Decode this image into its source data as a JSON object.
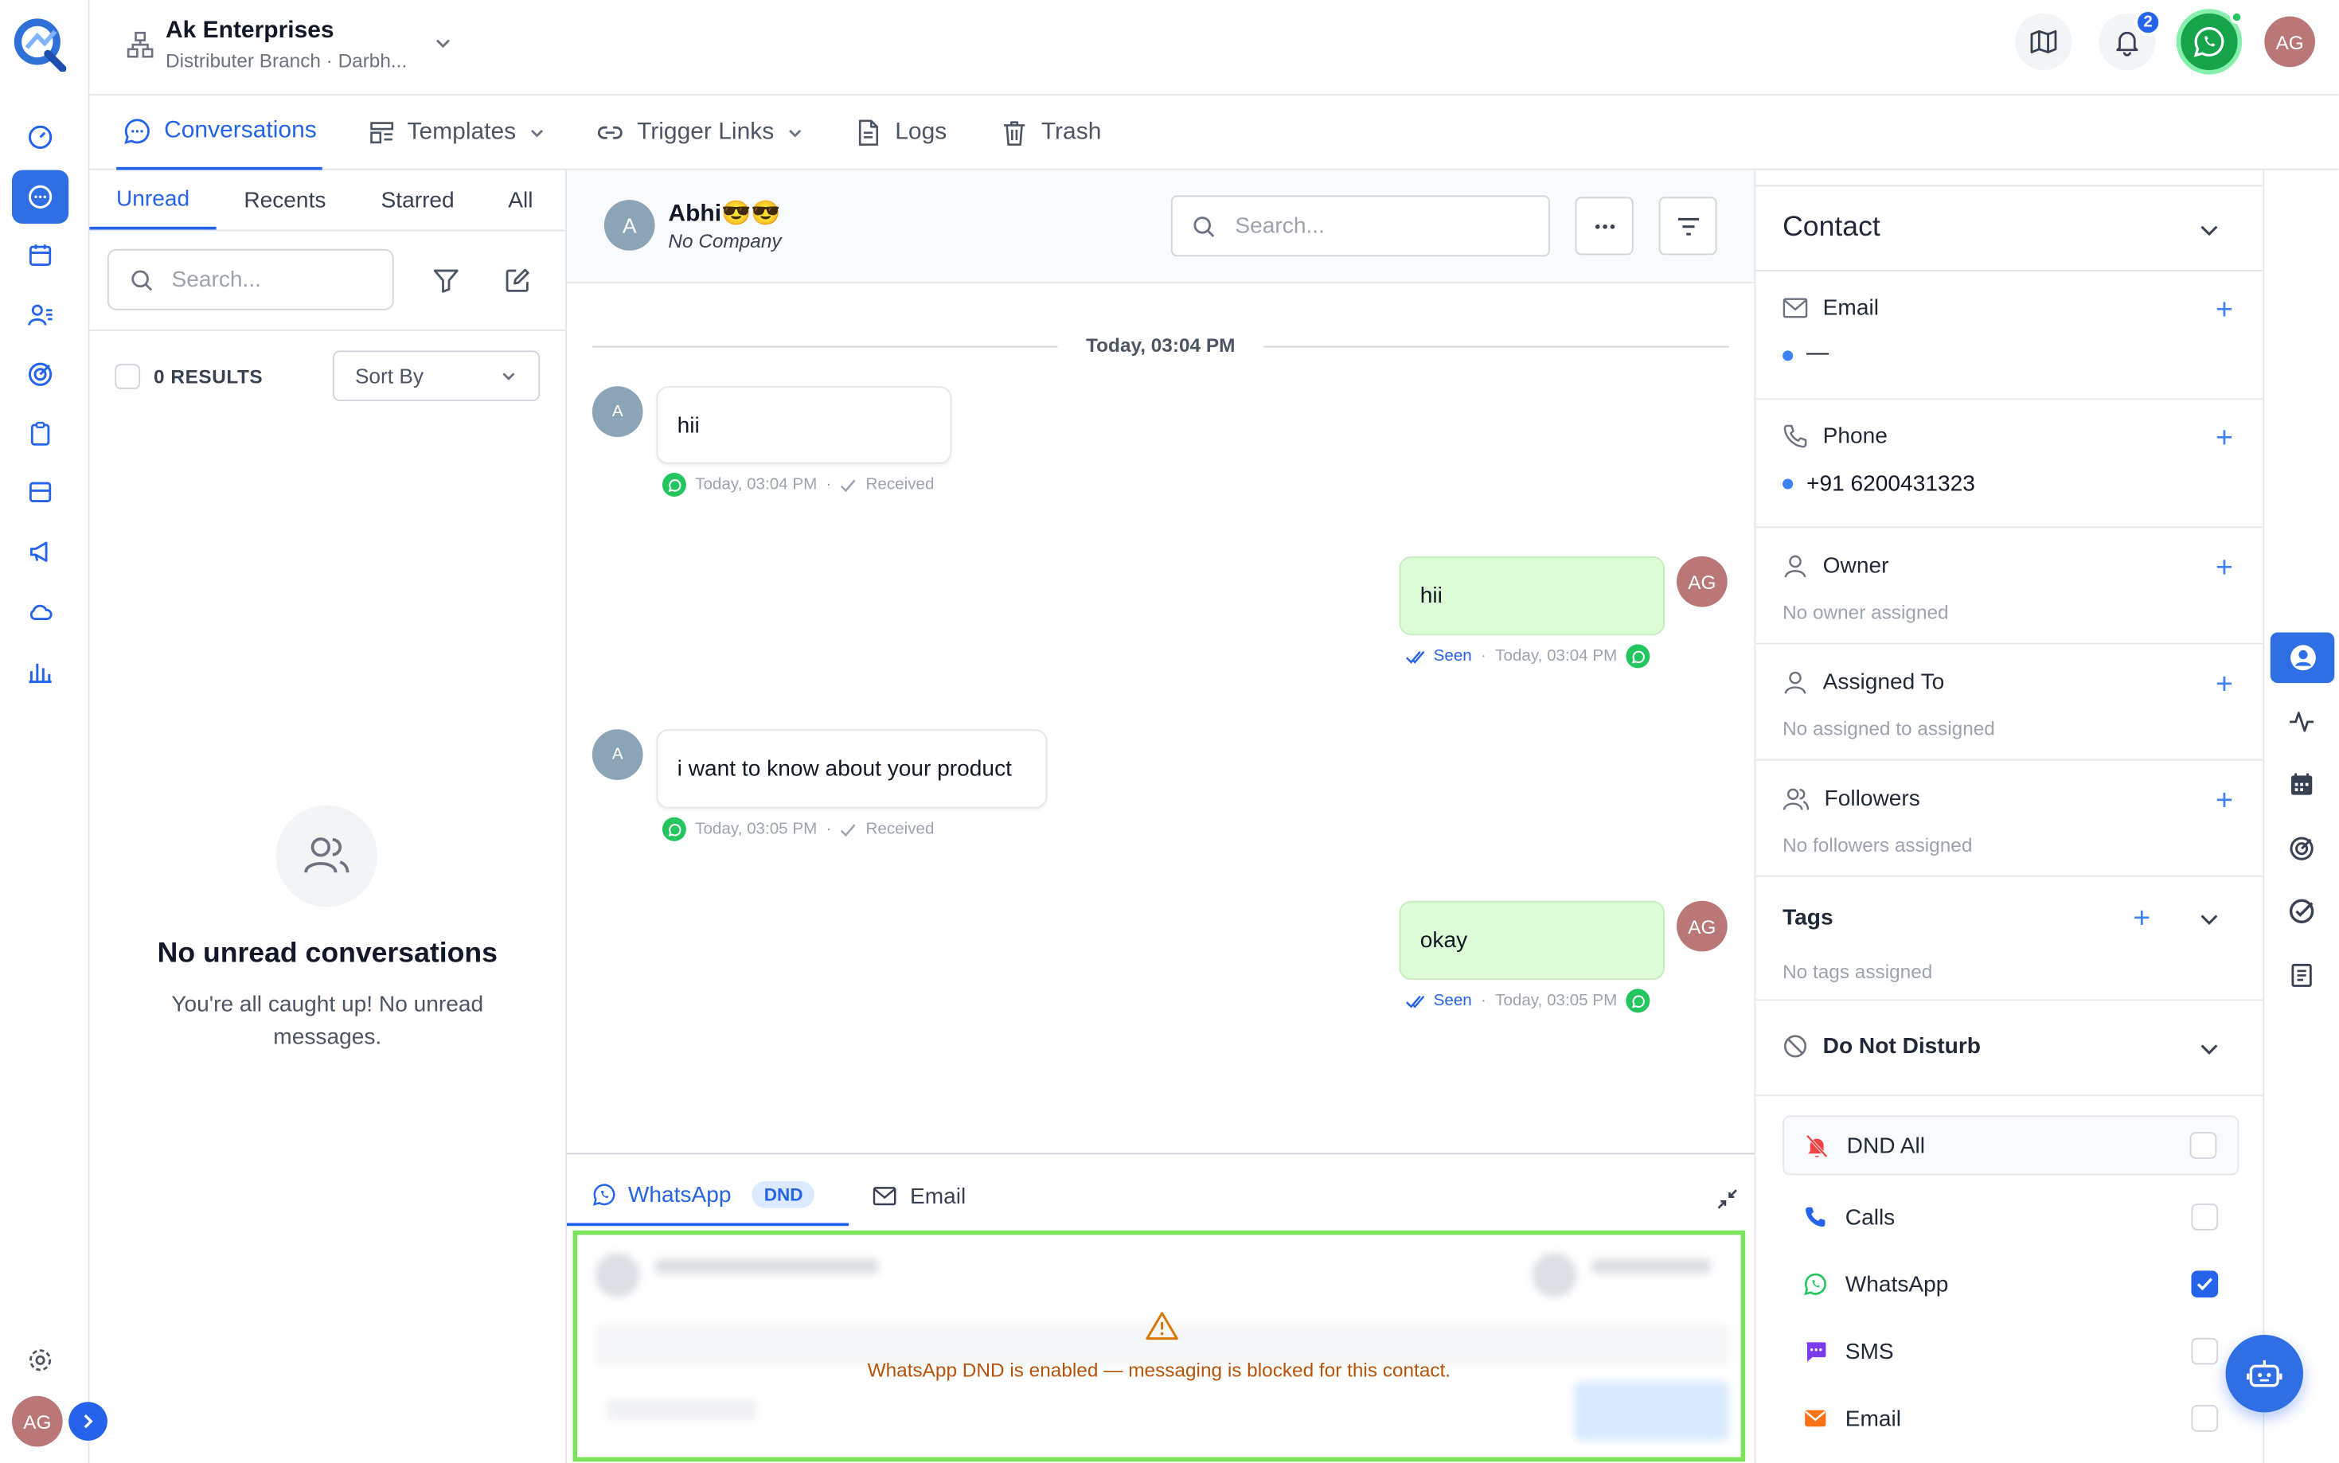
{
  "header": {
    "org_name": "Ak Enterprises",
    "org_sub": "Distributer Branch · Darbh...",
    "notification_count": "2",
    "user_initials": "AG"
  },
  "tabs": [
    {
      "label": "Conversations"
    },
    {
      "label": "Templates"
    },
    {
      "label": "Trigger Links"
    },
    {
      "label": "Logs"
    },
    {
      "label": "Trash"
    }
  ],
  "list": {
    "subtabs": [
      "Unread",
      "Recents",
      "Starred",
      "All"
    ],
    "search_placeholder": "Search...",
    "results": "0 RESULTS",
    "sort_label": "Sort By",
    "empty_title": "No unread conversations",
    "empty_text": "You're all caught up! No unread messages."
  },
  "chat": {
    "contact_initial": "A",
    "contact_name": "Abhi😎😎",
    "contact_company": "No Company",
    "search_placeholder": "Search...",
    "date_divider": "Today, 03:04 PM",
    "messages": [
      {
        "dir": "in",
        "text": "hii",
        "time": "Today, 03:04 PM",
        "status": "Received",
        "avatar": "A"
      },
      {
        "dir": "out",
        "text": "hii",
        "time": "Today, 03:04 PM",
        "status": "Seen",
        "avatar": "AG"
      },
      {
        "dir": "in",
        "text": "i want to know about your product",
        "time": "Today, 03:05 PM",
        "status": "Received",
        "avatar": "A"
      },
      {
        "dir": "out",
        "text": "okay",
        "time": "Today, 03:05 PM",
        "status": "Seen",
        "avatar": "AG"
      }
    ],
    "composer": {
      "channel_whatsapp": "WhatsApp",
      "dnd_badge": "DND",
      "channel_email": "Email",
      "dnd_warning": "WhatsApp DND is enabled — messaging is blocked for this contact."
    }
  },
  "contact_panel": {
    "title": "Contact",
    "email_label": "Email",
    "email_value": "—",
    "phone_label": "Phone",
    "phone_value": "+91 6200431323",
    "owner_label": "Owner",
    "owner_value": "No owner assigned",
    "assigned_label": "Assigned To",
    "assigned_value": "No assigned to assigned",
    "followers_label": "Followers",
    "followers_value": "No followers assigned",
    "tags_label": "Tags",
    "tags_value": "No tags assigned",
    "dnd_title": "Do Not Disturb",
    "dnd_items": [
      {
        "label": "DND All",
        "checked": false
      },
      {
        "label": "Calls",
        "checked": false
      },
      {
        "label": "WhatsApp",
        "checked": true
      },
      {
        "label": "SMS",
        "checked": false
      },
      {
        "label": "Email",
        "checked": false
      }
    ]
  },
  "colors": {
    "accent": "#2563eb",
    "whatsapp": "#22c55e",
    "warning": "#b45309",
    "composer_border": "#7ee35c"
  }
}
